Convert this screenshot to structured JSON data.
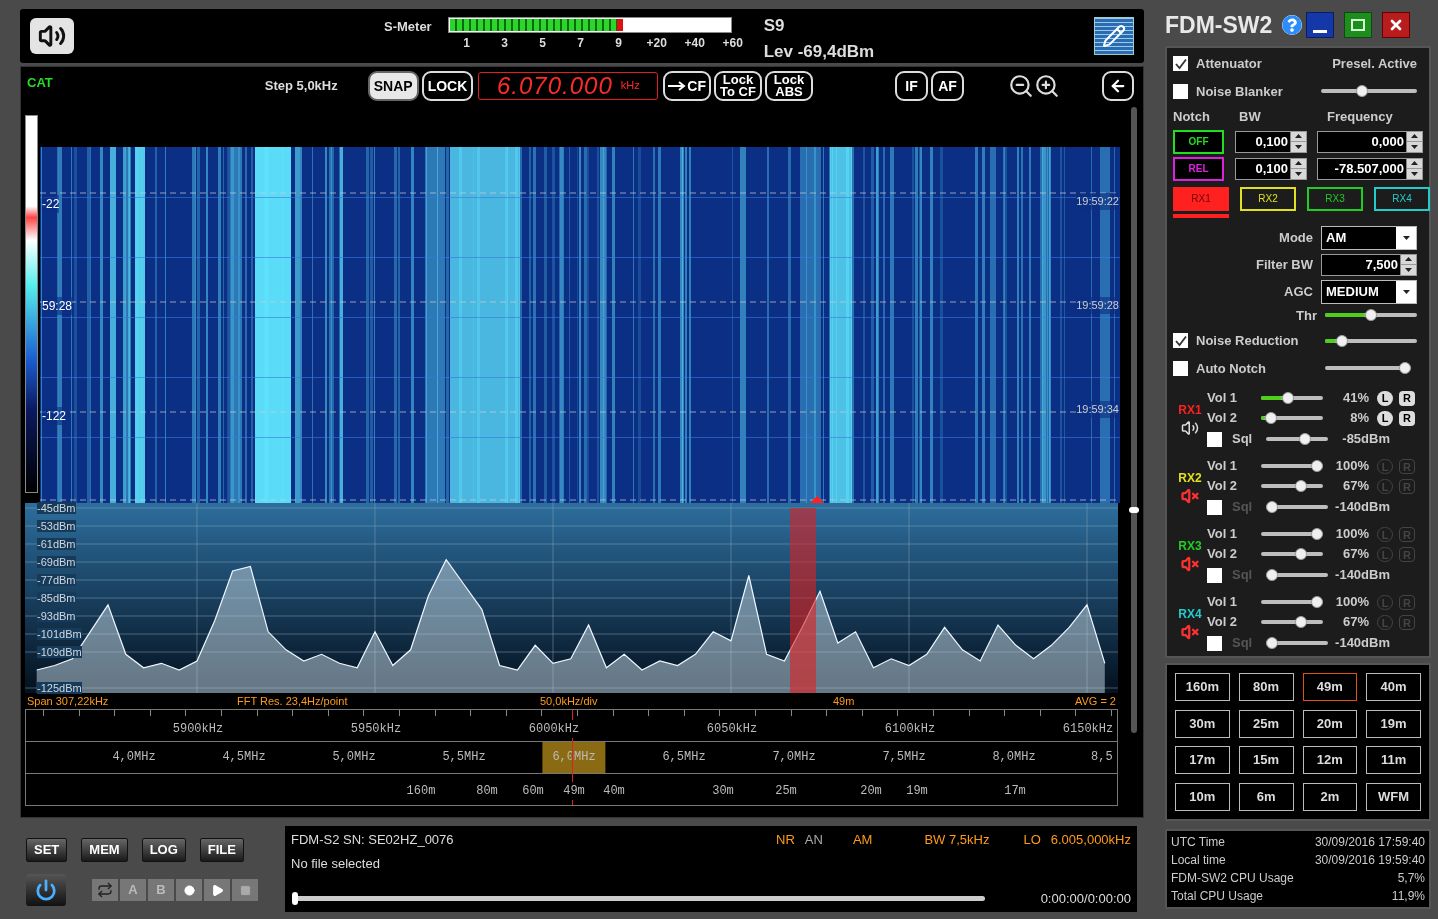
{
  "top_bar": {
    "s_meter_label": "S-Meter",
    "s_meter": {
      "level": 0.62
    },
    "s_meter_ticks": [
      "1",
      "3",
      "5",
      "7",
      "9",
      "+20",
      "+40",
      "+60"
    ],
    "s_reading": "S9",
    "level_reading": "Lev -69,4dBm"
  },
  "toolbar": {
    "cat": "CAT",
    "step": "Step 5,0kHz",
    "snap": {
      "label": "SNAP",
      "on": true
    },
    "lock": {
      "label": "LOCK",
      "on": false
    },
    "frequency": "6.070.000",
    "frequency_unit": "kHz",
    "to_cf": "CF",
    "lock_to_cf": "Lock To CF",
    "lock_abs": "Lock ABS",
    "if": "IF",
    "af": "AF"
  },
  "waterfall": {
    "scale_labels": [
      "-22",
      "59:28",
      "-122"
    ],
    "times": [
      "19:59:22",
      "19:59:28",
      "19:59:34"
    ]
  },
  "spectrum": {
    "chart_data": {
      "type": "area",
      "xlim": [
        5851.7,
        6158.7
      ],
      "ylim": [
        -125,
        -45
      ],
      "yticks": [
        {
          "value": -45,
          "label": "-45dBm"
        },
        {
          "value": -53,
          "label": "-53dBm"
        },
        {
          "value": -61,
          "label": "-61dBm"
        },
        {
          "value": -69,
          "label": "-69dBm"
        },
        {
          "value": -77,
          "label": "-77dBm"
        },
        {
          "value": -85,
          "label": "-85dBm"
        },
        {
          "value": -93,
          "label": "-93dBm"
        },
        {
          "value": -101,
          "label": "-101dBm"
        },
        {
          "value": -109,
          "label": "-109dBm"
        },
        {
          "value": -125,
          "label": "-125dBm"
        }
      ],
      "x": [
        5855,
        5860,
        5865,
        5870,
        5875,
        5880,
        5885,
        5890,
        5895,
        5900,
        5905,
        5910,
        5915,
        5920,
        5925,
        5930,
        5935,
        5940,
        5945,
        5950,
        5955,
        5960,
        5965,
        5970,
        5975,
        5980,
        5985,
        5990,
        5995,
        6000,
        6005,
        6010,
        6015,
        6020,
        6025,
        6030,
        6035,
        6040,
        6045,
        6050,
        6055,
        6060,
        6065,
        6070,
        6075,
        6080,
        6085,
        6090,
        6095,
        6100,
        6105,
        6110,
        6115,
        6120,
        6125,
        6130,
        6135,
        6140,
        6145,
        6150,
        6155
      ],
      "xticks": [
        {
          "value": 5900,
          "label": "5900kHz"
        },
        {
          "value": 5950,
          "label": "5950kHz"
        },
        {
          "value": 6000,
          "label": "6000kHz"
        },
        {
          "value": 6050,
          "label": "6050kHz"
        },
        {
          "value": 6100,
          "label": "6100kHz"
        },
        {
          "value": 6150,
          "label": "6150kHz"
        }
      ],
      "grid": true,
      "series": [
        {
          "color": "#eef6ff",
          "values": [
            -117,
            -115,
            -112,
            -100,
            -88,
            -110,
            -116,
            -114,
            -117,
            -113,
            -95,
            -73,
            -71,
            -100,
            -108,
            -113,
            -110,
            -114,
            -116,
            -100,
            -115,
            -108,
            -84,
            -68,
            -79,
            -90,
            -115,
            -117,
            -106,
            -114,
            -112,
            -97,
            -116,
            -110,
            -117,
            -113,
            -115,
            -110,
            -100,
            -104,
            -75,
            -110,
            -113,
            -98,
            -82,
            -105,
            -100,
            -116,
            -112,
            -115,
            -110,
            -98,
            -108,
            -113,
            -97,
            -106,
            -112,
            -106,
            -98,
            -88,
            -114
          ]
        }
      ]
    },
    "footer": {
      "span": "Span 307,22kHz",
      "fft": "FFT Res. 23,4Hz/point",
      "division": "50,0kHz/div",
      "band": "49m",
      "avg": "AVG = 2"
    },
    "mhz_scale": [
      {
        "label": "4,0MHz",
        "selected": false
      },
      {
        "label": "4,5MHz",
        "selected": false
      },
      {
        "label": "5,0MHz",
        "selected": false
      },
      {
        "label": "5,5MHz",
        "selected": false
      },
      {
        "label": "6,0MHz",
        "selected": true
      },
      {
        "label": "6,5MHz",
        "selected": false
      },
      {
        "label": "7,0MHz",
        "selected": false
      },
      {
        "label": "7,5MHz",
        "selected": false
      },
      {
        "label": "8,0MHz",
        "selected": false
      },
      {
        "label": "8,5",
        "selected": false
      }
    ],
    "meter_bands": [
      "160m",
      "80m",
      "60m",
      "49m",
      "40m",
      "30m",
      "25m",
      "20m",
      "19m",
      "17m"
    ]
  },
  "bottom": {
    "buttons": [
      "SET",
      "MEM",
      "LOG",
      "FILE"
    ],
    "transport_letters": [
      "A",
      "B"
    ],
    "device": "FDM-S2 SN: SE02HZ_0076",
    "file": "No file selected",
    "indicators": [
      {
        "label": "NR",
        "on": true
      },
      {
        "label": "AN",
        "on": false
      }
    ],
    "mode": "AM",
    "bandwidth": "BW 7,5kHz",
    "lo_label": "LO",
    "lo_value": "6.005,000kHz",
    "playback": {
      "level": 0
    },
    "time": "0:00:00/0:00:00"
  },
  "side_panel": {
    "title": "FDM-SW2",
    "options": [
      {
        "label": "Attenuator",
        "checked": true
      },
      {
        "label": "Noise Blanker",
        "checked": false
      }
    ],
    "presel": "Presel. Active",
    "noise_blanker": {
      "level": 0.42
    },
    "notch_headers": [
      "Notch",
      "BW",
      "Frequency"
    ],
    "notches": [
      {
        "button": "OFF",
        "color": "#22dd22",
        "bw": "0,100",
        "frequency": "0,000"
      },
      {
        "button": "REL",
        "color": "#dd22dd",
        "bw": "0,100",
        "frequency": "-78.507,000"
      }
    ],
    "receivers": [
      {
        "label": "RX1",
        "color": "#ff2020",
        "selected": true
      },
      {
        "label": "RX2",
        "color": "#e0e020",
        "selected": false
      },
      {
        "label": "RX3",
        "color": "#22cc22",
        "selected": false
      },
      {
        "label": "RX4",
        "color": "#22cccc",
        "selected": false
      }
    ],
    "mode_label": "Mode",
    "mode": "AM",
    "filter_label": "Filter BW",
    "filter_bw": "7,500",
    "agc_label": "AGC",
    "agc": "MEDIUM",
    "thr_label": "Thr",
    "thr": {
      "level": 0.5
    },
    "noise_reduction": {
      "label": "Noise Reduction",
      "checked": true,
      "level": 0.14
    },
    "auto_notch": {
      "label": "Auto Notch",
      "checked": false,
      "level": 1.0
    },
    "audio": [
      {
        "label": "RX1",
        "color": "#ff2020",
        "muted": false,
        "disabled": false,
        "vols": [
          {
            "label": "Vol 1",
            "level": 0.41,
            "reading": "41%",
            "l": "L",
            "r": "R"
          },
          {
            "label": "Vol 2",
            "level": 0.08,
            "reading": "8%",
            "l": "L",
            "r": "R"
          }
        ],
        "sql": {
          "label": "Sql",
          "checked": false,
          "level": 0.65,
          "reading": "-85dBm"
        }
      },
      {
        "label": "RX2",
        "color": "#e0e020",
        "muted": true,
        "disabled": true,
        "vols": [
          {
            "label": "Vol 1",
            "level": 1.0,
            "reading": "100%",
            "l": "L",
            "r": "R"
          },
          {
            "label": "Vol 2",
            "level": 0.67,
            "reading": "67%",
            "l": "L",
            "r": "R"
          }
        ],
        "sql": {
          "label": "Sql",
          "checked": false,
          "level": 0,
          "reading": "-140dBm"
        }
      },
      {
        "label": "RX3",
        "color": "#22cc22",
        "muted": true,
        "disabled": true,
        "vols": [
          {
            "label": "Vol 1",
            "level": 1.0,
            "reading": "100%",
            "l": "L",
            "r": "R"
          },
          {
            "label": "Vol 2",
            "level": 0.67,
            "reading": "67%",
            "l": "L",
            "r": "R"
          }
        ],
        "sql": {
          "label": "Sql",
          "checked": false,
          "level": 0,
          "reading": "-140dBm"
        }
      },
      {
        "label": "RX4",
        "color": "#22cccc",
        "muted": true,
        "disabled": true,
        "vols": [
          {
            "label": "Vol 1",
            "level": 1.0,
            "reading": "100%",
            "l": "L",
            "r": "R"
          },
          {
            "label": "Vol 2",
            "level": 0.67,
            "reading": "67%",
            "l": "L",
            "r": "R"
          }
        ],
        "sql": {
          "label": "Sql",
          "checked": false,
          "level": 0,
          "reading": "-140dBm"
        }
      }
    ],
    "bands": [
      {
        "label": "160m",
        "selected": false
      },
      {
        "label": "80m",
        "selected": false
      },
      {
        "label": "49m",
        "selected": true
      },
      {
        "label": "40m",
        "selected": false
      },
      {
        "label": "30m",
        "selected": false
      },
      {
        "label": "25m",
        "selected": false
      },
      {
        "label": "20m",
        "selected": false
      },
      {
        "label": "19m",
        "selected": false
      },
      {
        "label": "17m",
        "selected": false
      },
      {
        "label": "15m",
        "selected": false
      },
      {
        "label": "12m",
        "selected": false
      },
      {
        "label": "11m",
        "selected": false
      },
      {
        "label": "10m",
        "selected": false
      },
      {
        "label": "6m",
        "selected": false
      },
      {
        "label": "2m",
        "selected": false
      },
      {
        "label": "WFM",
        "selected": false
      }
    ],
    "status": [
      {
        "label": "UTC Time",
        "value": "30/09/2016 17:59:40"
      },
      {
        "label": "Local time",
        "value": "30/09/2016 19:59:40"
      },
      {
        "label": "FDM-SW2 CPU Usage",
        "value": "5,7%"
      },
      {
        "label": "Total CPU Usage",
        "value": "11,9%"
      }
    ]
  }
}
